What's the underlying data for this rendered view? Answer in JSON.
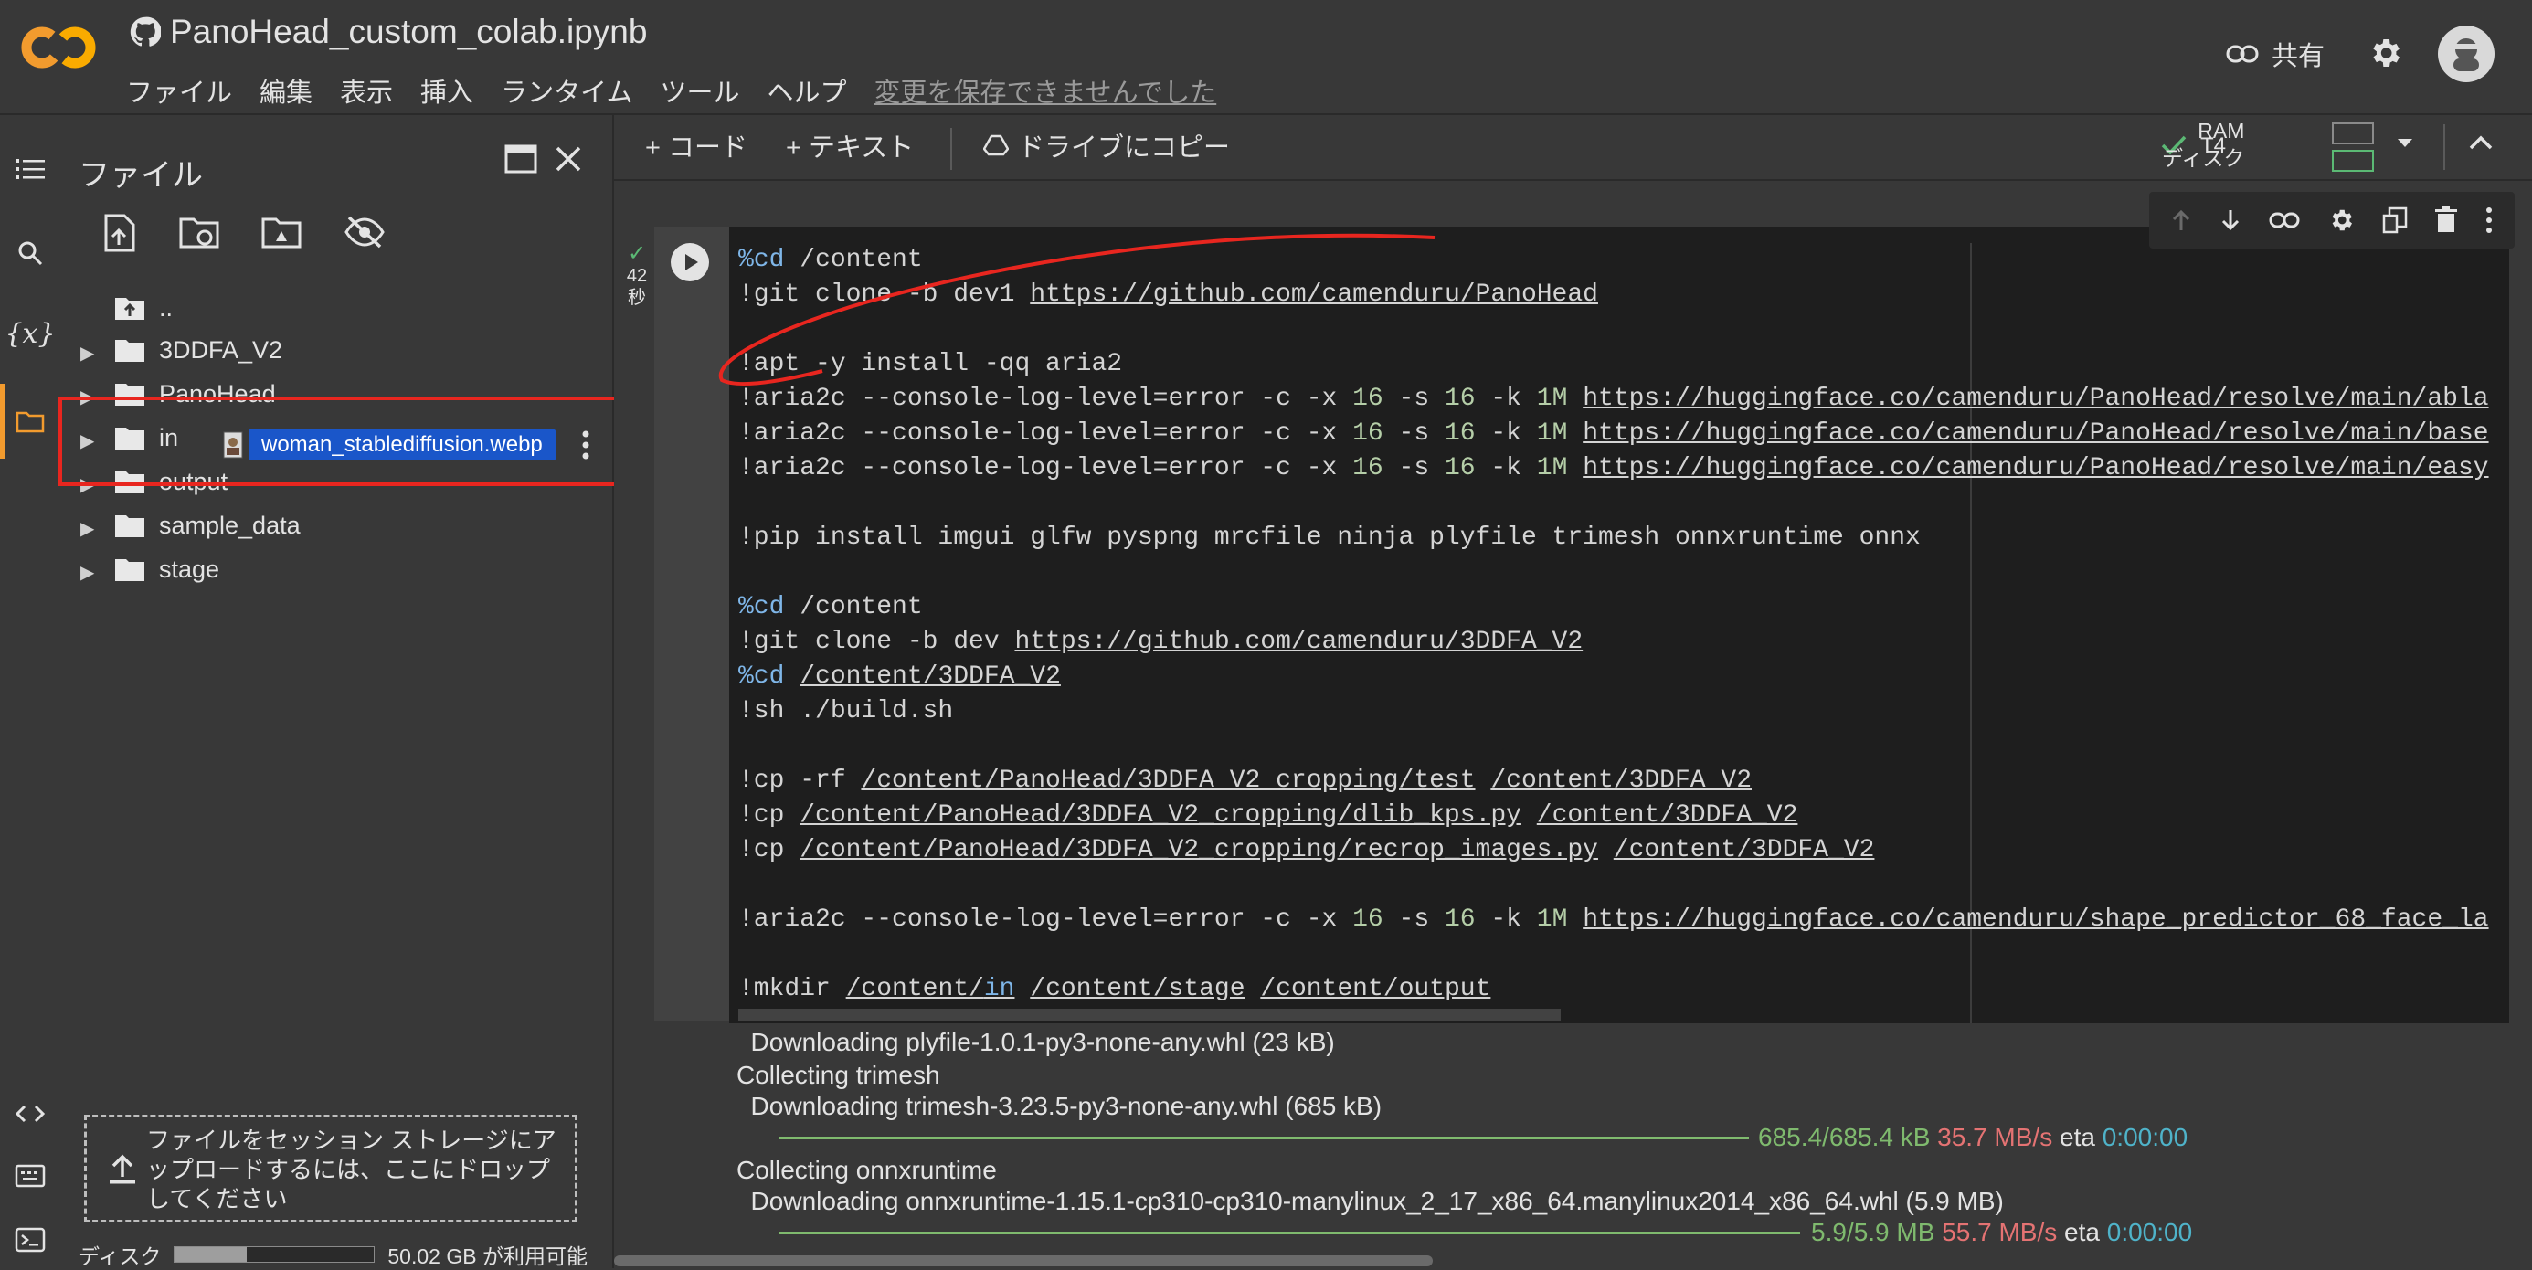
{
  "header": {
    "title": "PanoHead_custom_colab.ipynb",
    "menu": [
      "ファイル",
      "編集",
      "表示",
      "挿入",
      "ランタイム",
      "ツール",
      "ヘルプ"
    ],
    "unsaved_notice": "変更を保存できませんでした",
    "share_label": "共有"
  },
  "files_panel": {
    "title": "ファイル",
    "tree": [
      {
        "name": "..",
        "kind": "up"
      },
      {
        "name": "3DDFA_V2",
        "kind": "folder"
      },
      {
        "name": "PanoHead",
        "kind": "folder"
      },
      {
        "name": "in",
        "kind": "folder"
      },
      {
        "name": "output",
        "kind": "folder"
      },
      {
        "name": "sample_data",
        "kind": "folder"
      },
      {
        "name": "stage",
        "kind": "folder"
      }
    ],
    "dragged_file": "woman_stablediffusion.webp",
    "drop_hint": "ファイルをセッション ストレージにアップロードするには、ここにドロップしてください",
    "disk_label": "ディスク",
    "disk_available": "50.02 GB が利用可能",
    "disk_used_fraction": 0.36
  },
  "toolbar": {
    "add_code": "+ コード",
    "add_text": "+ テキスト",
    "copy_drive": "ドライブにコピー",
    "gpu": "T4",
    "ram_label": "RAM",
    "disk_label": "ディスク"
  },
  "cell": {
    "exec_time": "42",
    "exec_unit": "秒",
    "code_lines": [
      "%cd /content",
      "!git clone -b dev1 https://github.com/camenduru/PanoHead",
      "",
      "!apt -y install -qq aria2",
      "!aria2c --console-log-level=error -c -x 16 -s 16 -k 1M https://huggingface.co/camenduru/PanoHead/resolve/main/abla",
      "!aria2c --console-log-level=error -c -x 16 -s 16 -k 1M https://huggingface.co/camenduru/PanoHead/resolve/main/base",
      "!aria2c --console-log-level=error -c -x 16 -s 16 -k 1M https://huggingface.co/camenduru/PanoHead/resolve/main/easy",
      "",
      "!pip install imgui glfw pyspng mrcfile ninja plyfile trimesh onnxruntime onnx",
      "",
      "%cd /content",
      "!git clone -b dev https://github.com/camenduru/3DDFA_V2",
      "%cd /content/3DDFA_V2",
      "!sh ./build.sh",
      "",
      "!cp -rf /content/PanoHead/3DDFA_V2_cropping/test /content/3DDFA_V2",
      "!cp /content/PanoHead/3DDFA_V2_cropping/dlib_kps.py /content/3DDFA_V2",
      "!cp /content/PanoHead/3DDFA_V2_cropping/recrop_images.py /content/3DDFA_V2",
      "",
      "!aria2c --console-log-level=error -c -x 16 -s 16 -k 1M https://huggingface.co/camenduru/shape_predictor_68_face_la",
      "",
      "!mkdir /content/in /content/stage /content/output"
    ]
  },
  "output": {
    "l1": "  Downloading plyfile-1.0.1-py3-none-any.whl (23 kB)",
    "l2": "Collecting trimesh",
    "l3": "  Downloading trimesh-3.23.5-py3-none-any.whl (685 kB)",
    "p1_size": "685.4/685.4 kB",
    "p1_speed": "35.7 MB/s",
    "p1_eta_label": "eta",
    "p1_eta": "0:00:00",
    "l5": "Collecting onnxruntime",
    "l6": "  Downloading onnxruntime-1.15.1-cp310-cp310-manylinux_2_17_x86_64.manylinux2014_x86_64.whl (5.9 MB)",
    "p2_size": "5.9/5.9 MB",
    "p2_speed": "55.7 MB/s",
    "p2_eta_label": "eta",
    "p2_eta": "0:00:00"
  }
}
